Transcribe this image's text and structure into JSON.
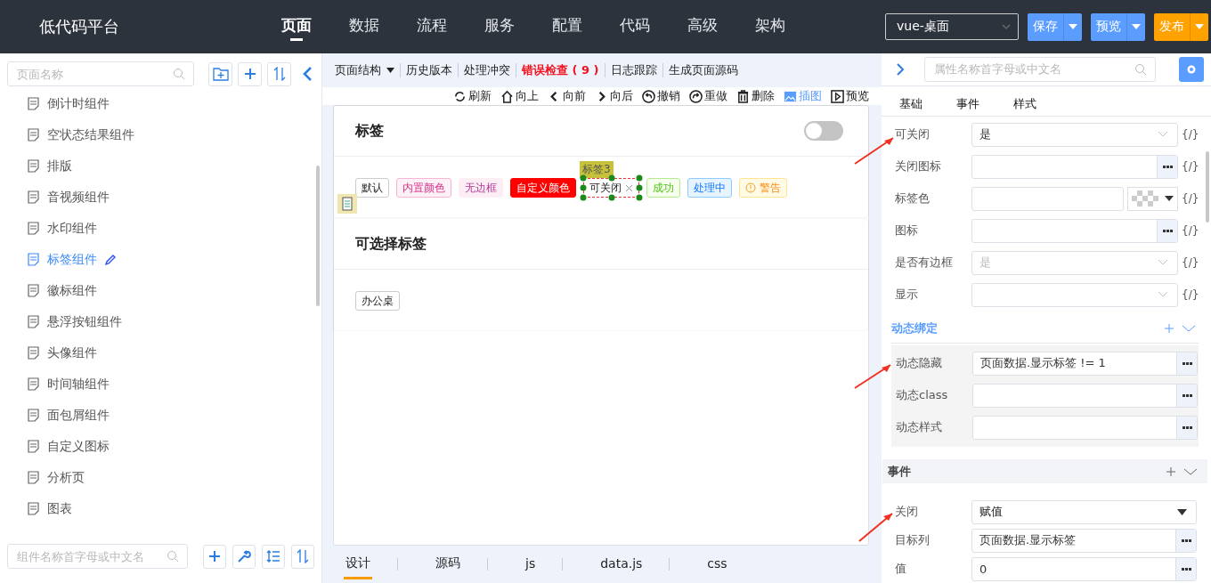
{
  "header": {
    "logo": "低代码平台",
    "nav": [
      {
        "label": "页面",
        "selected": true
      },
      {
        "label": "数据",
        "selected": false
      },
      {
        "label": "流程",
        "selected": false
      },
      {
        "label": "服务",
        "selected": false
      },
      {
        "label": "配置",
        "selected": false
      },
      {
        "label": "代码",
        "selected": false
      },
      {
        "label": "高级",
        "selected": false
      },
      {
        "label": "架构",
        "selected": false
      }
    ],
    "env_select": "vue-桌面",
    "buttons": [
      {
        "label": "保存",
        "kind": "primary"
      },
      {
        "label": "预览",
        "kind": "primary"
      },
      {
        "label": "发布",
        "kind": "warning"
      }
    ]
  },
  "left": {
    "search": {
      "placeholder": "页面名称"
    },
    "pages": [
      {
        "label": "倒计时组件",
        "selected": false
      },
      {
        "label": "空状态结果组件",
        "selected": false
      },
      {
        "label": "排版",
        "selected": false
      },
      {
        "label": "音视频组件",
        "selected": false
      },
      {
        "label": "水印组件",
        "selected": false
      },
      {
        "label": "标签组件",
        "selected": true
      },
      {
        "label": "徽标组件",
        "selected": false
      },
      {
        "label": "悬浮按钮组件",
        "selected": false
      },
      {
        "label": "头像组件",
        "selected": false
      },
      {
        "label": "时间轴组件",
        "selected": false
      },
      {
        "label": "面包屑组件",
        "selected": false
      },
      {
        "label": "自定义图标",
        "selected": false
      },
      {
        "label": "分析页",
        "selected": false
      },
      {
        "label": "图表",
        "selected": false
      }
    ],
    "component_search": {
      "placeholder": "组件名称首字母或中文名"
    }
  },
  "center": {
    "menu": [
      {
        "label": "页面结构",
        "kind": "dropdown"
      },
      {
        "label": "历史版本",
        "kind": "plain"
      },
      {
        "label": "处理冲突",
        "kind": "plain"
      },
      {
        "label": "错误检查 ( 9 )",
        "kind": "error"
      },
      {
        "label": "日志跟踪",
        "kind": "plain"
      },
      {
        "label": "生成页面源码",
        "kind": "plain"
      }
    ],
    "actions": [
      {
        "label": "刷新",
        "kind": "refresh",
        "active": false
      },
      {
        "label": "向上",
        "kind": "up",
        "active": false
      },
      {
        "label": "向前",
        "kind": "prev",
        "active": false
      },
      {
        "label": "向后",
        "kind": "next",
        "active": false
      },
      {
        "label": "撤销",
        "kind": "undo",
        "active": false
      },
      {
        "label": "重做",
        "kind": "redo",
        "active": false
      },
      {
        "label": "删除",
        "kind": "delete",
        "active": false
      },
      {
        "label": "插图",
        "kind": "image",
        "active": true
      },
      {
        "label": "预览",
        "kind": "preview",
        "active": false
      }
    ],
    "cards": [
      {
        "title": "标签",
        "switch": {
          "on": false
        },
        "selection_label": "标签3",
        "tags": [
          {
            "label": "默认",
            "kind": "default",
            "selected": false
          },
          {
            "label": "内置颜色",
            "kind": "pink",
            "selected": false
          },
          {
            "label": "无边框",
            "kind": "borderless",
            "selected": false
          },
          {
            "label": "自定义颜色",
            "kind": "custom",
            "selected": false
          },
          {
            "label": "可关闭",
            "kind": "closable",
            "selected": true
          },
          {
            "label": "成功",
            "kind": "success",
            "selected": false
          },
          {
            "label": "处理中",
            "kind": "processing",
            "selected": false
          },
          {
            "label": "警告",
            "kind": "warning",
            "selected": false
          }
        ]
      },
      {
        "title": "可选择标签",
        "tags": [
          {
            "label": "办公桌",
            "kind": "default",
            "selected": false
          }
        ]
      }
    ],
    "tabs": [
      {
        "label": "设计",
        "selected": true
      },
      {
        "label": "源码",
        "selected": false
      },
      {
        "label": "js",
        "selected": false
      },
      {
        "label": "data.js",
        "selected": false
      },
      {
        "label": "css",
        "selected": false
      }
    ]
  },
  "right": {
    "search": {
      "placeholder": "属性名称首字母或中文名"
    },
    "tabs": [
      "基础",
      "事件",
      "样式"
    ],
    "properties": [
      {
        "label": "可关闭",
        "kind": "select",
        "value": "是",
        "expression": "{/}"
      },
      {
        "label": "关闭图标",
        "kind": "more",
        "expression": "{/}"
      },
      {
        "label": "标签色",
        "kind": "color",
        "expression": "{/}"
      },
      {
        "label": "图标",
        "kind": "more",
        "expression": "{/}"
      },
      {
        "label": "是否有边框",
        "kind": "select",
        "placeholder": "是",
        "expression": "{/}"
      },
      {
        "label": "显示",
        "kind": "select",
        "expression": "{/}"
      }
    ],
    "binding": {
      "title": "动态绑定",
      "rows": [
        {
          "label": "动态隐藏",
          "value": "页面数据.显示标签 != 1"
        },
        {
          "label": "动态class"
        },
        {
          "label": "动态样式"
        }
      ]
    },
    "events": {
      "title": "事件",
      "rows": [
        {
          "label": "关闭",
          "kind": "dropdown",
          "value": "赋值"
        },
        {
          "label": "目标列",
          "kind": "more",
          "value": "页面数据.显示标签"
        },
        {
          "label": "值",
          "kind": "more",
          "value": "0"
        }
      ]
    }
  }
}
